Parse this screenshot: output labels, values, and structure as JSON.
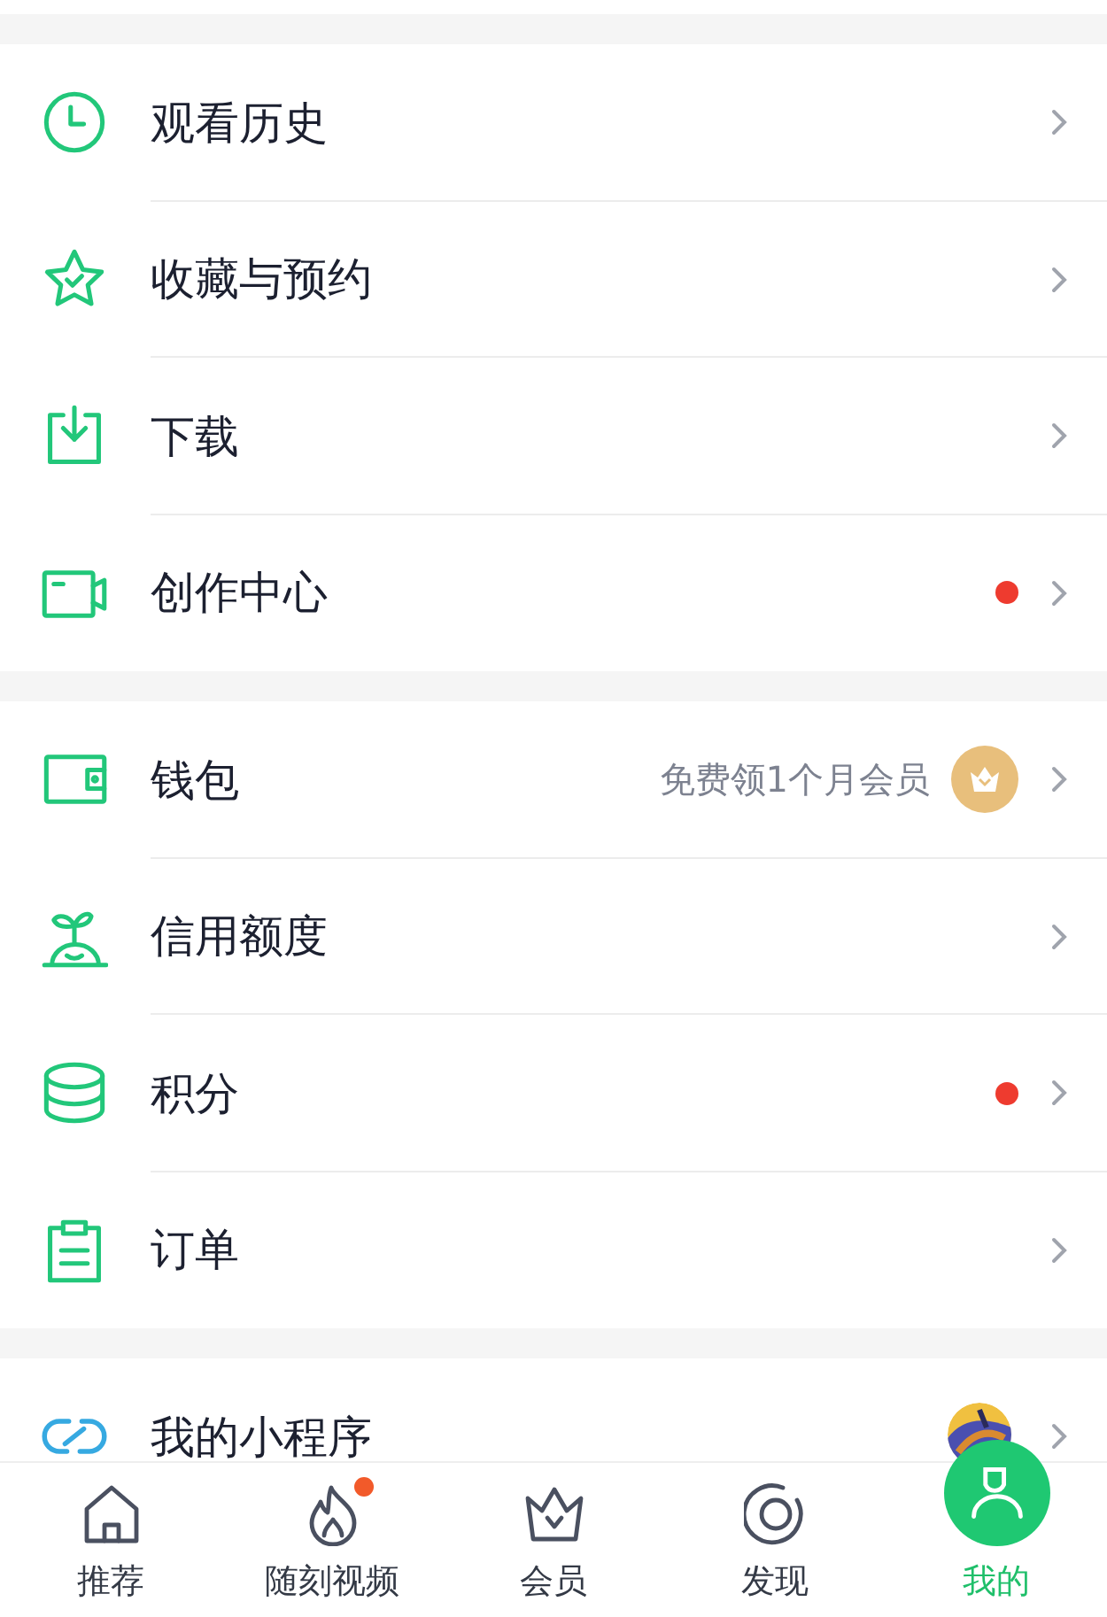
{
  "sections": [
    {
      "items": [
        {
          "kind": "clock",
          "label": "观看历史",
          "dot": false
        },
        {
          "kind": "star",
          "label": "收藏与预约",
          "dot": false
        },
        {
          "kind": "download",
          "label": "下载",
          "dot": false
        },
        {
          "kind": "camera",
          "label": "创作中心",
          "dot": true
        }
      ]
    },
    {
      "items": [
        {
          "kind": "wallet",
          "label": "钱包",
          "dot": false,
          "hint": "免费领1个月会员",
          "crown_badge": true
        },
        {
          "kind": "sprout",
          "label": "信用额度",
          "dot": false
        },
        {
          "kind": "coins",
          "label": "积分",
          "dot": true
        },
        {
          "kind": "clipboard",
          "label": "订单",
          "dot": false
        }
      ]
    },
    {
      "items": [
        {
          "kind": "link",
          "label": "我的小程序",
          "dot": false,
          "thumbnail": true
        }
      ]
    }
  ],
  "tabs": [
    {
      "kind": "home",
      "label": "推荐",
      "selected": false,
      "dot": false
    },
    {
      "kind": "flame",
      "label": "随刻视频",
      "selected": false,
      "dot": true
    },
    {
      "kind": "crown",
      "label": "会员",
      "selected": false,
      "dot": false
    },
    {
      "kind": "discover",
      "label": "发现",
      "selected": false,
      "dot": false
    },
    {
      "kind": "person",
      "label": "我的",
      "selected": true,
      "dot": false
    }
  ]
}
